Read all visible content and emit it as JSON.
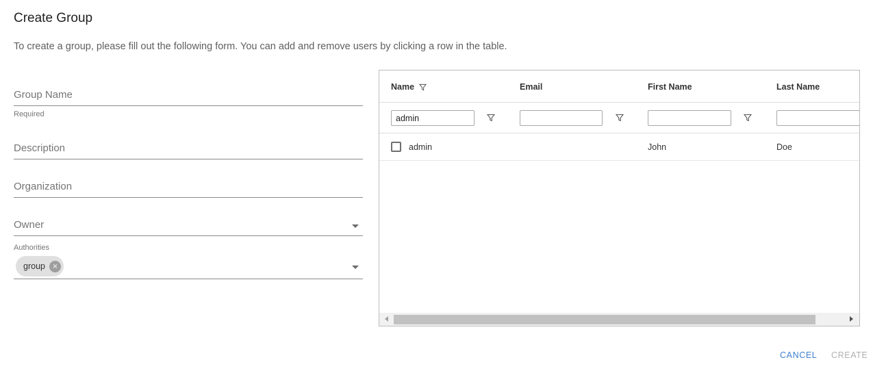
{
  "dialog": {
    "title": "Create Group",
    "description": "To create a group, please fill out the following form. You can add and remove users by clicking a row in the table."
  },
  "form": {
    "group_name": {
      "placeholder": "Group Name",
      "helper": "Required"
    },
    "description": {
      "placeholder": "Description"
    },
    "organization": {
      "placeholder": "Organization"
    },
    "owner": {
      "placeholder": "Owner"
    },
    "authorities": {
      "label": "Authorities",
      "chips": [
        "group"
      ]
    }
  },
  "table": {
    "columns": [
      "Name",
      "Email",
      "First Name",
      "Last Name"
    ],
    "filters": [
      "admin",
      "",
      "",
      ""
    ],
    "rows": [
      {
        "selected": false,
        "name": "admin",
        "email": "",
        "first_name": "John",
        "last_name": "Doe"
      }
    ]
  },
  "actions": {
    "cancel": "CANCEL",
    "create": "CREATE"
  },
  "colors": {
    "primary": "#3f7fcf",
    "disabled": "#b0b0b0"
  },
  "icons": {
    "column_filter": "funnel-icon",
    "chip_remove": "cancel-circle-icon",
    "dropdown": "caret-down-icon"
  }
}
